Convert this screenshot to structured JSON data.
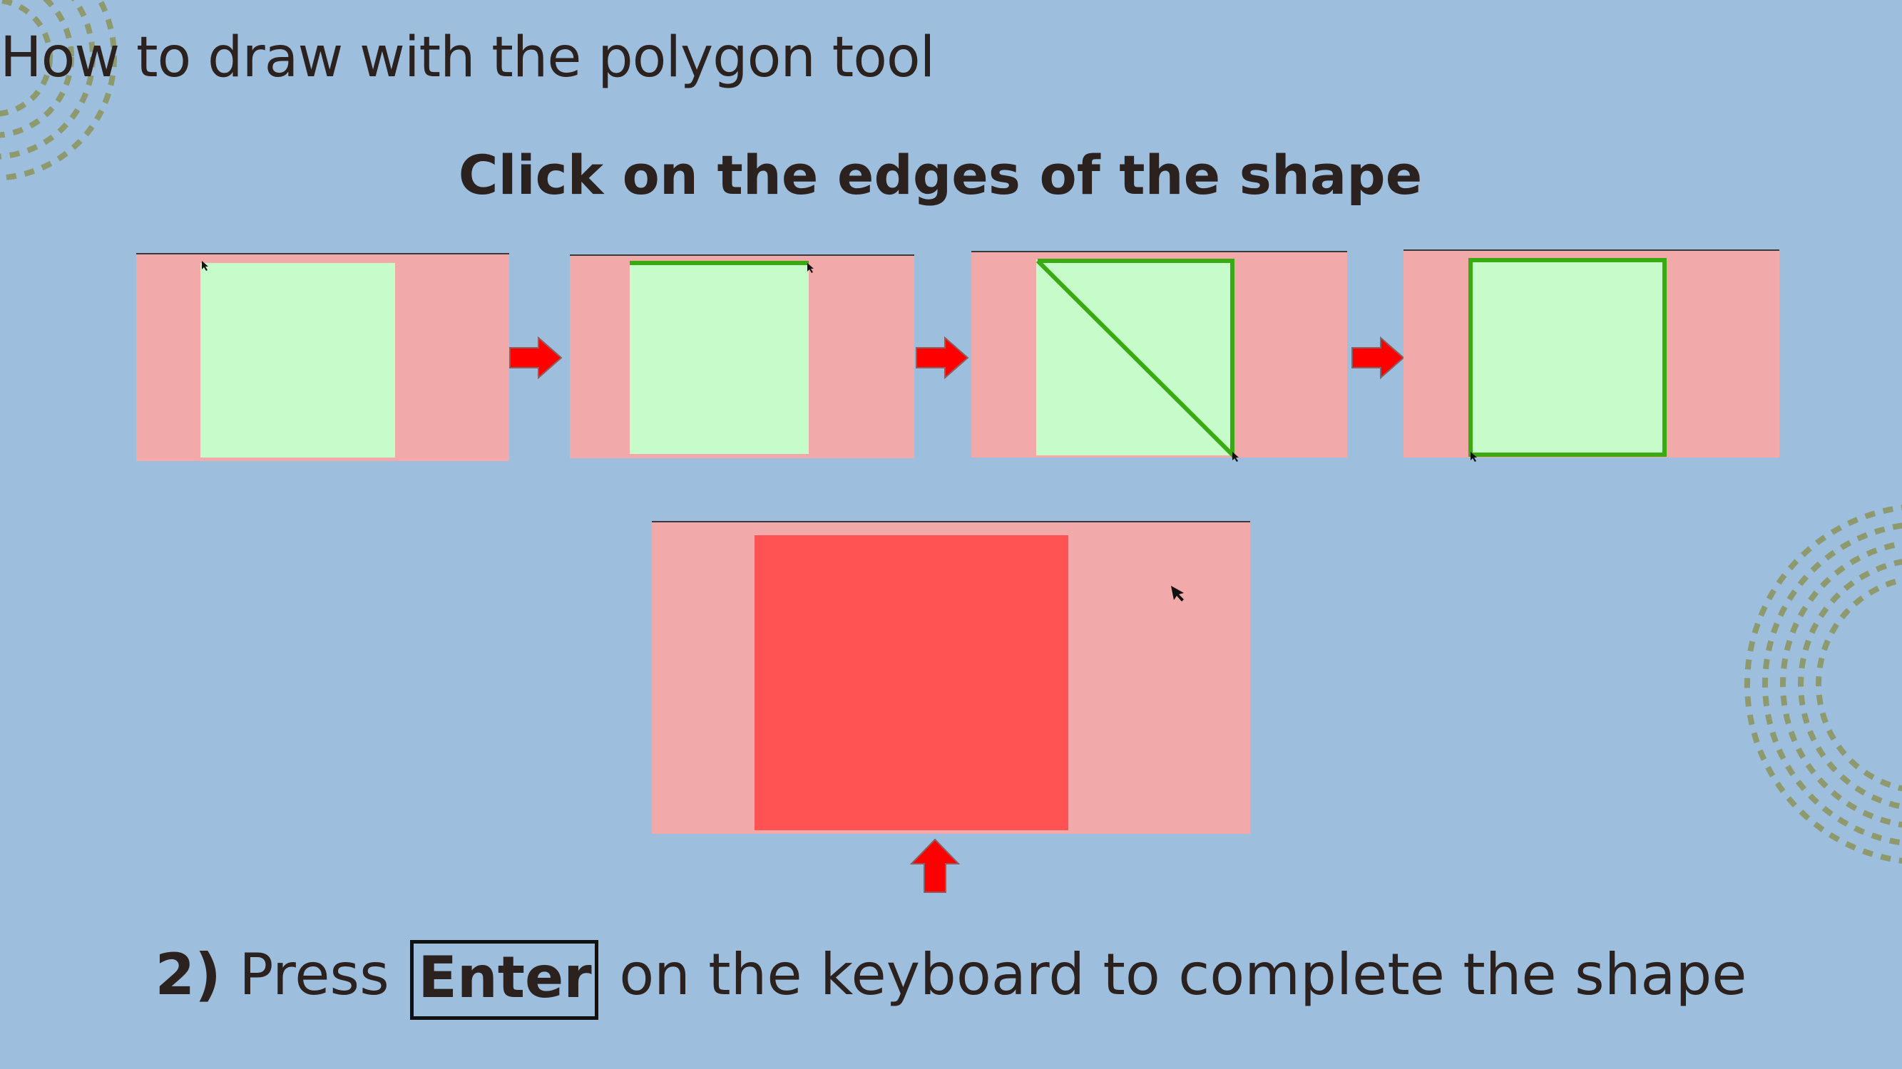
{
  "title": "How to draw with the polygon tool",
  "subtitle": "Click on the edges of the shape",
  "instruction": {
    "step": "2)",
    "before": "Press",
    "key": "Enter",
    "after": "on the keyboard to complete the shape"
  },
  "colors": {
    "background": "#9dbedc",
    "panel": "#f2a9aa",
    "shape_fill": "#c5fcca",
    "outline": "#3aaa12",
    "completed_shape": "#ff5252",
    "arrow": "#ff0000",
    "decoration": "#8e9a6e"
  },
  "icons": [
    "cursor-arrow-icon",
    "right-arrow-icon",
    "up-arrow-icon"
  ]
}
